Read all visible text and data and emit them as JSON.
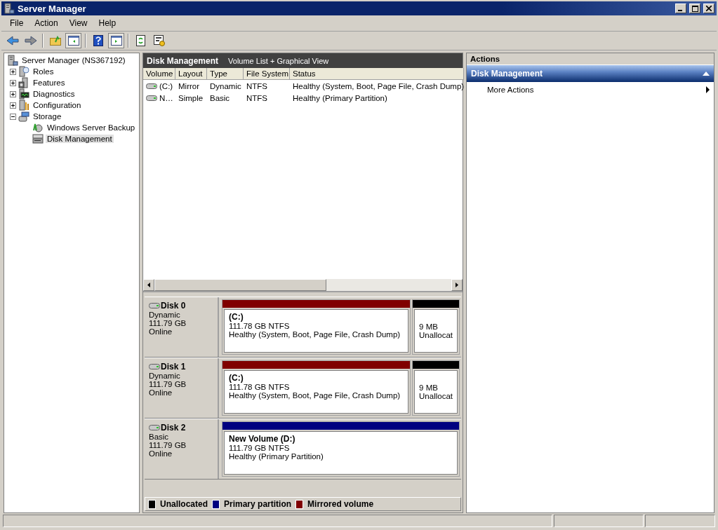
{
  "window": {
    "title": "Server Manager"
  },
  "menu": [
    "File",
    "Action",
    "View",
    "Help"
  ],
  "tree": {
    "label": "Server Manager (NS367192)",
    "selected": false,
    "children": [
      {
        "label": "Roles",
        "expanded": false,
        "selected": false
      },
      {
        "label": "Features",
        "expanded": false,
        "selected": false
      },
      {
        "label": "Diagnostics",
        "expanded": false,
        "selected": false
      },
      {
        "label": "Configuration",
        "expanded": false,
        "selected": false
      },
      {
        "label": "Storage",
        "expanded": true,
        "selected": false,
        "children": [
          {
            "label": "Windows Server Backup",
            "selected": false
          },
          {
            "label": "Disk Management",
            "selected": true
          }
        ]
      }
    ]
  },
  "center": {
    "title": "Disk Management",
    "subtitle": "Volume List + Graphical View"
  },
  "table": {
    "columns": [
      "Volume",
      "Layout",
      "Type",
      "File System",
      "Status"
    ],
    "rows": [
      [
        "(C:)",
        "Mirror",
        "Dynamic",
        "NTFS",
        "Healthy (System, Boot, Page File, Crash Dump)"
      ],
      [
        "N…",
        "Simple",
        "Basic",
        "NTFS",
        "Healthy (Primary Partition)"
      ]
    ]
  },
  "disks": [
    {
      "name": "Disk 0",
      "type": "Dynamic",
      "size": "111.79 GB",
      "status": "Online",
      "partitions": [
        {
          "kind": "mirrored",
          "label": "(C:)",
          "size": "111.78 GB NTFS",
          "status": "Healthy (System, Boot, Page File, Crash Dump)"
        },
        {
          "kind": "unallocated",
          "size": "9 MB",
          "status": "Unallocat"
        }
      ]
    },
    {
      "name": "Disk 1",
      "type": "Dynamic",
      "size": "111.79 GB",
      "status": "Online",
      "partitions": [
        {
          "kind": "mirrored",
          "label": "(C:)",
          "size": "111.78 GB NTFS",
          "status": "Healthy (System, Boot, Page File, Crash Dump)"
        },
        {
          "kind": "unallocated",
          "size": "9 MB",
          "status": "Unallocat"
        }
      ]
    },
    {
      "name": "Disk 2",
      "type": "Basic",
      "size": "111.79 GB",
      "status": "Online",
      "partitions": [
        {
          "kind": "primary",
          "label": "New Volume  (D:)",
          "size": "111.79 GB NTFS",
          "status": "Healthy (Primary Partition)"
        }
      ]
    }
  ],
  "legend": [
    {
      "label": "Unallocated",
      "color": "#000000"
    },
    {
      "label": "Primary partition",
      "color": "#000080"
    },
    {
      "label": "Mirrored volume",
      "color": "#800000"
    }
  ],
  "actions": {
    "title": "Actions",
    "section": "Disk Management",
    "expanded": true,
    "items": [
      "More Actions"
    ]
  }
}
